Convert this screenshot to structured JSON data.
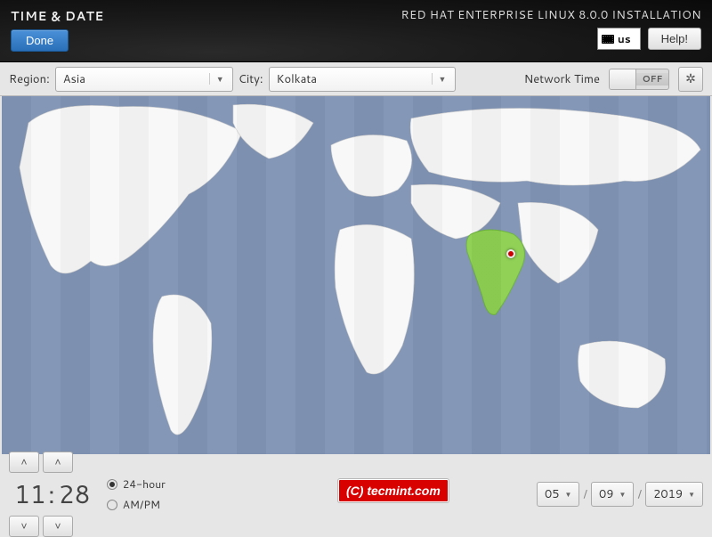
{
  "header": {
    "page_title": "TIME & DATE",
    "done_label": "Done",
    "installer_title": "RED HAT ENTERPRISE LINUX 8.0.0 INSTALLATION",
    "keyboard_layout": "us",
    "help_label": "Help!"
  },
  "toolbar": {
    "region_label": "Region:",
    "region_value": "Asia",
    "city_label": "City:",
    "city_value": "Kolkata",
    "network_time_label": "Network Time",
    "network_time_state": "OFF"
  },
  "map": {
    "highlighted_country": "India",
    "selected_city": "Kolkata"
  },
  "time": {
    "hours": "11",
    "minutes": "28",
    "format_24_label": "24-hour",
    "format_ampm_label": "AM/PM",
    "format_selected": "24-hour"
  },
  "date": {
    "month": "05",
    "day": "09",
    "year": "2019"
  },
  "watermark": "(C) tecmint.com"
}
